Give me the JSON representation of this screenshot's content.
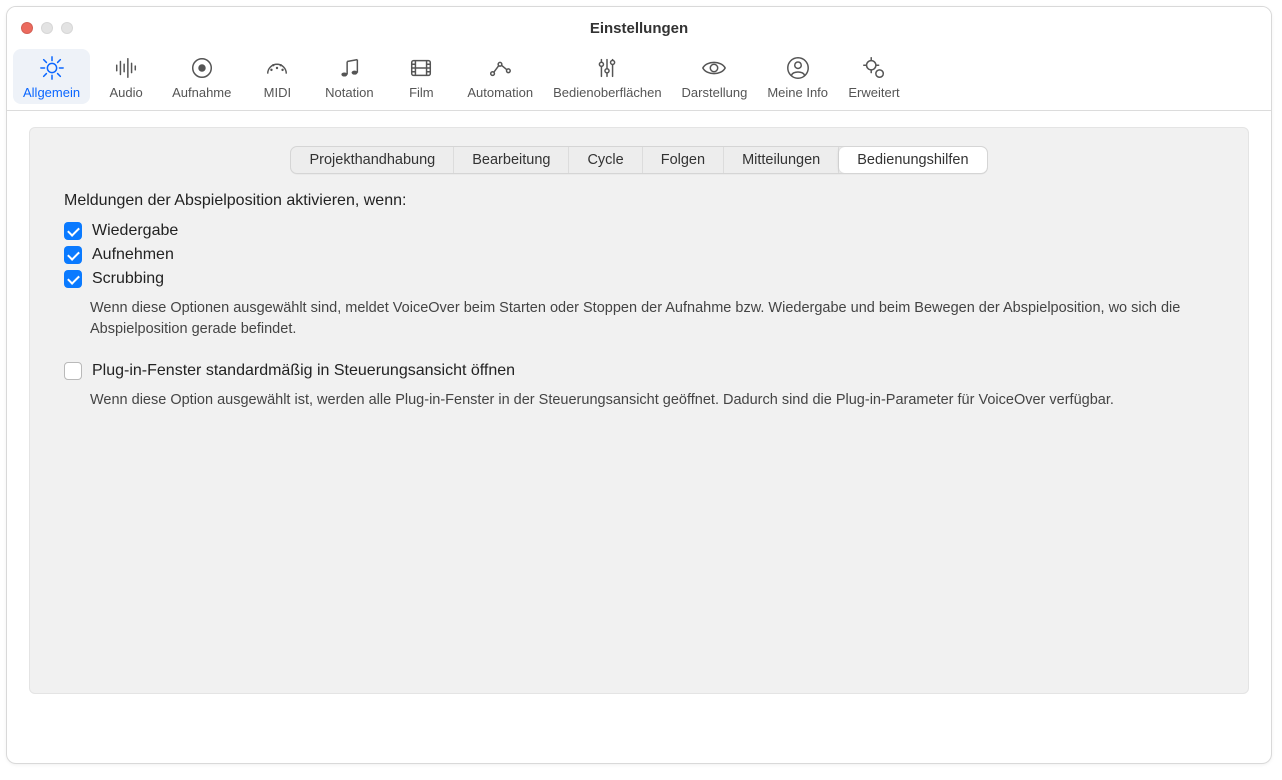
{
  "window": {
    "title": "Einstellungen"
  },
  "toolbar": [
    {
      "id": "allgemein",
      "label": "Allgemein",
      "active": true
    },
    {
      "id": "audio",
      "label": "Audio",
      "active": false
    },
    {
      "id": "aufnahme",
      "label": "Aufnahme",
      "active": false
    },
    {
      "id": "midi",
      "label": "MIDI",
      "active": false
    },
    {
      "id": "notation",
      "label": "Notation",
      "active": false
    },
    {
      "id": "film",
      "label": "Film",
      "active": false
    },
    {
      "id": "automation",
      "label": "Automation",
      "active": false
    },
    {
      "id": "bedienoberflaechen",
      "label": "Bedienoberflächen",
      "active": false
    },
    {
      "id": "darstellung",
      "label": "Darstellung",
      "active": false
    },
    {
      "id": "meineinfo",
      "label": "Meine Info",
      "active": false
    },
    {
      "id": "erweitert",
      "label": "Erweitert",
      "active": false
    }
  ],
  "segments": [
    {
      "id": "projekthandhabung",
      "label": "Projekthandhabung",
      "selected": false
    },
    {
      "id": "bearbeitung",
      "label": "Bearbeitung",
      "selected": false
    },
    {
      "id": "cycle",
      "label": "Cycle",
      "selected": false
    },
    {
      "id": "folgen",
      "label": "Folgen",
      "selected": false
    },
    {
      "id": "mitteilungen",
      "label": "Mitteilungen",
      "selected": false
    },
    {
      "id": "bedienungshilfen",
      "label": "Bedienungshilfen",
      "selected": true
    }
  ],
  "section1": {
    "heading": "Meldungen der Abspielposition aktivieren, wenn:",
    "items": [
      {
        "id": "wiedergabe",
        "label": "Wiedergabe",
        "checked": true
      },
      {
        "id": "aufnehmen",
        "label": "Aufnehmen",
        "checked": true
      },
      {
        "id": "scrubbing",
        "label": "Scrubbing",
        "checked": true
      }
    ],
    "description": "Wenn diese Optionen ausgewählt sind, meldet VoiceOver beim Starten oder Stoppen der Aufnahme bzw. Wiedergabe und beim Bewegen der Abspielposition, wo sich die Abspielposition gerade befindet."
  },
  "section2": {
    "item": {
      "id": "plugin",
      "label": "Plug-in-Fenster standardmäßig in Steuerungsansicht öffnen",
      "checked": false
    },
    "description": "Wenn diese Option ausgewählt ist, werden alle Plug-in-Fenster in der Steuerungsansicht geöffnet. Dadurch sind die Plug-in-Parameter für VoiceOver verfügbar."
  }
}
